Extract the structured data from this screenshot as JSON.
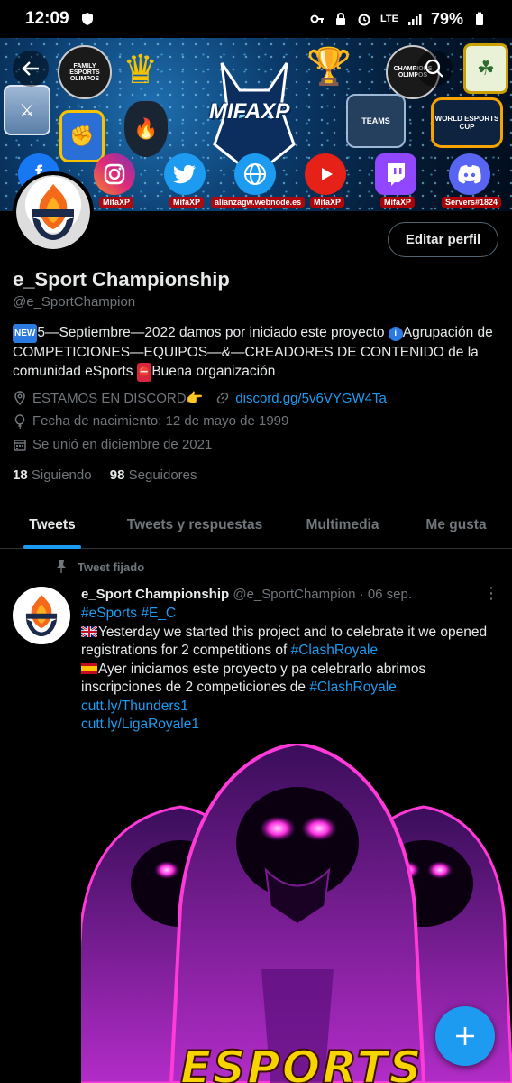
{
  "status_bar": {
    "time": "12:09",
    "network": "LTE",
    "battery": "79%"
  },
  "banner": {
    "mifa_text": "MIFAXP",
    "logos": [
      "FAMILY ESPORTS OLIMPOS",
      "CHAMPIONS OLIMPOS",
      "TEAMS",
      "WORLD ESPORTS CUP"
    ],
    "social": [
      {
        "icon": "facebook-icon",
        "label": "",
        "color": "#1877f2"
      },
      {
        "icon": "instagram-icon",
        "label": "MifaXP",
        "color": "#d62976"
      },
      {
        "icon": "twitter-icon",
        "label": "MifaXP",
        "color": "#1d9bf0"
      },
      {
        "icon": "globe-icon",
        "label": "alianzagw.webnode.es",
        "color": "#1d9bf0"
      },
      {
        "icon": "youtube-icon",
        "label": "MifaXP",
        "color": "#e62117"
      },
      {
        "icon": "twitch-icon",
        "label": "MifaXP",
        "color": "#9146ff"
      },
      {
        "icon": "discord-icon",
        "label": "Servers#1824",
        "color": "#5865f2"
      }
    ]
  },
  "profile": {
    "edit_button": "Editar perfil",
    "name": "e_Sport Championship",
    "handle": "@e_SportChampion",
    "bio": {
      "part1": "5—Septiembre—2022 damos por iniciado este proyecto ",
      "part2": "Agrupación de COMPETICIONES—EQUIPOS—&—CREADORES DE CONTENIDO de la comunidad eSports ",
      "part3": "Buena organización",
      "badge_new": "NEW"
    },
    "location": "ESTAMOS EN DISCORD👉",
    "link": "discord.gg/5v6VYGW4Ta",
    "birthday": "Fecha de nacimiento: 12 de mayo de 1999",
    "joined": "Se unió en diciembre de 2021",
    "following_count": "18",
    "following_label": "Siguiendo",
    "followers_count": "98",
    "followers_label": "Seguidores"
  },
  "tabs": [
    {
      "label": "Tweets",
      "active": true
    },
    {
      "label": "Tweets y respuestas",
      "active": false
    },
    {
      "label": "Multimedia",
      "active": false
    },
    {
      "label": "Me gusta",
      "active": false
    }
  ],
  "tweet": {
    "pinned_label": "Tweet fijado",
    "name": "e_Sport Championship",
    "handle_date": "@e_SportChampion · 06 sep.",
    "hashtags": "#eSports #E_C",
    "line_en": "Yesterday we started this project and to celebrate it we opened registrations for 2 competitions of ",
    "tag_en": "#ClashRoyale",
    "line_es": "Ayer iniciamos este proyecto y pa celebrarlo abrimos inscripciones de 2 competiciones de ",
    "tag_es": "#ClashRoyale",
    "link1": "cutt.ly/Thunders1",
    "link2": "cutt.ly/LigaRoyale1",
    "media_text": "ESPORTS"
  },
  "colors": {
    "accent": "#1d9bf0",
    "muted": "#71767b",
    "text": "#e7e9ea",
    "background": "#000000"
  }
}
